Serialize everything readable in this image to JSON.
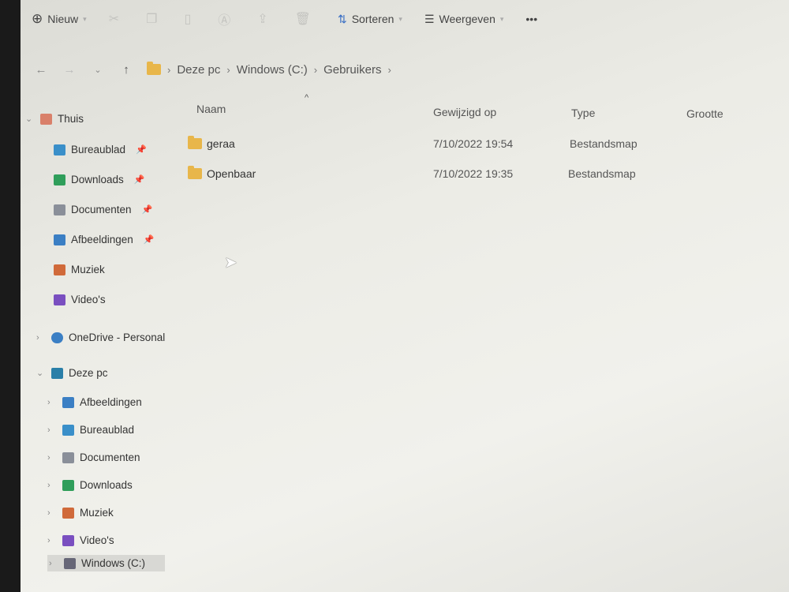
{
  "toolbar": {
    "new": "Nieuw",
    "sort": "Sorteren",
    "view": "Weergeven",
    "more": "•••"
  },
  "breadcrumb": [
    "Deze pc",
    "Windows (C:)",
    "Gebruikers"
  ],
  "sidebar": {
    "home": "Thuis",
    "quick": [
      {
        "label": "Bureaublad",
        "color": "#3a8fc9"
      },
      {
        "label": "Downloads",
        "color": "#2f9e5a"
      },
      {
        "label": "Documenten",
        "color": "#8a8f99"
      },
      {
        "label": "Afbeeldingen",
        "color": "#3b7fc4"
      },
      {
        "label": "Muziek",
        "color": "#d06a3a"
      },
      {
        "label": "Video's",
        "color": "#7a4fc0"
      }
    ],
    "onedrive": "OneDrive - Personal",
    "thispc": "Deze pc",
    "pc": [
      {
        "label": "Afbeeldingen",
        "color": "#3b7fc4"
      },
      {
        "label": "Bureaublad",
        "color": "#3a8fc9"
      },
      {
        "label": "Documenten",
        "color": "#8a8f99"
      },
      {
        "label": "Downloads",
        "color": "#2f9e5a"
      },
      {
        "label": "Muziek",
        "color": "#d06a3a"
      },
      {
        "label": "Video's",
        "color": "#7a4fc0"
      },
      {
        "label": "Windows (C:)",
        "color": "#667"
      }
    ]
  },
  "columns": {
    "name": "Naam",
    "modified": "Gewijzigd op",
    "type": "Type",
    "size": "Grootte"
  },
  "files": [
    {
      "name": "geraa",
      "modified": "7/10/2022 19:54",
      "type": "Bestandsmap"
    },
    {
      "name": "Openbaar",
      "modified": "7/10/2022 19:35",
      "type": "Bestandsmap"
    }
  ]
}
